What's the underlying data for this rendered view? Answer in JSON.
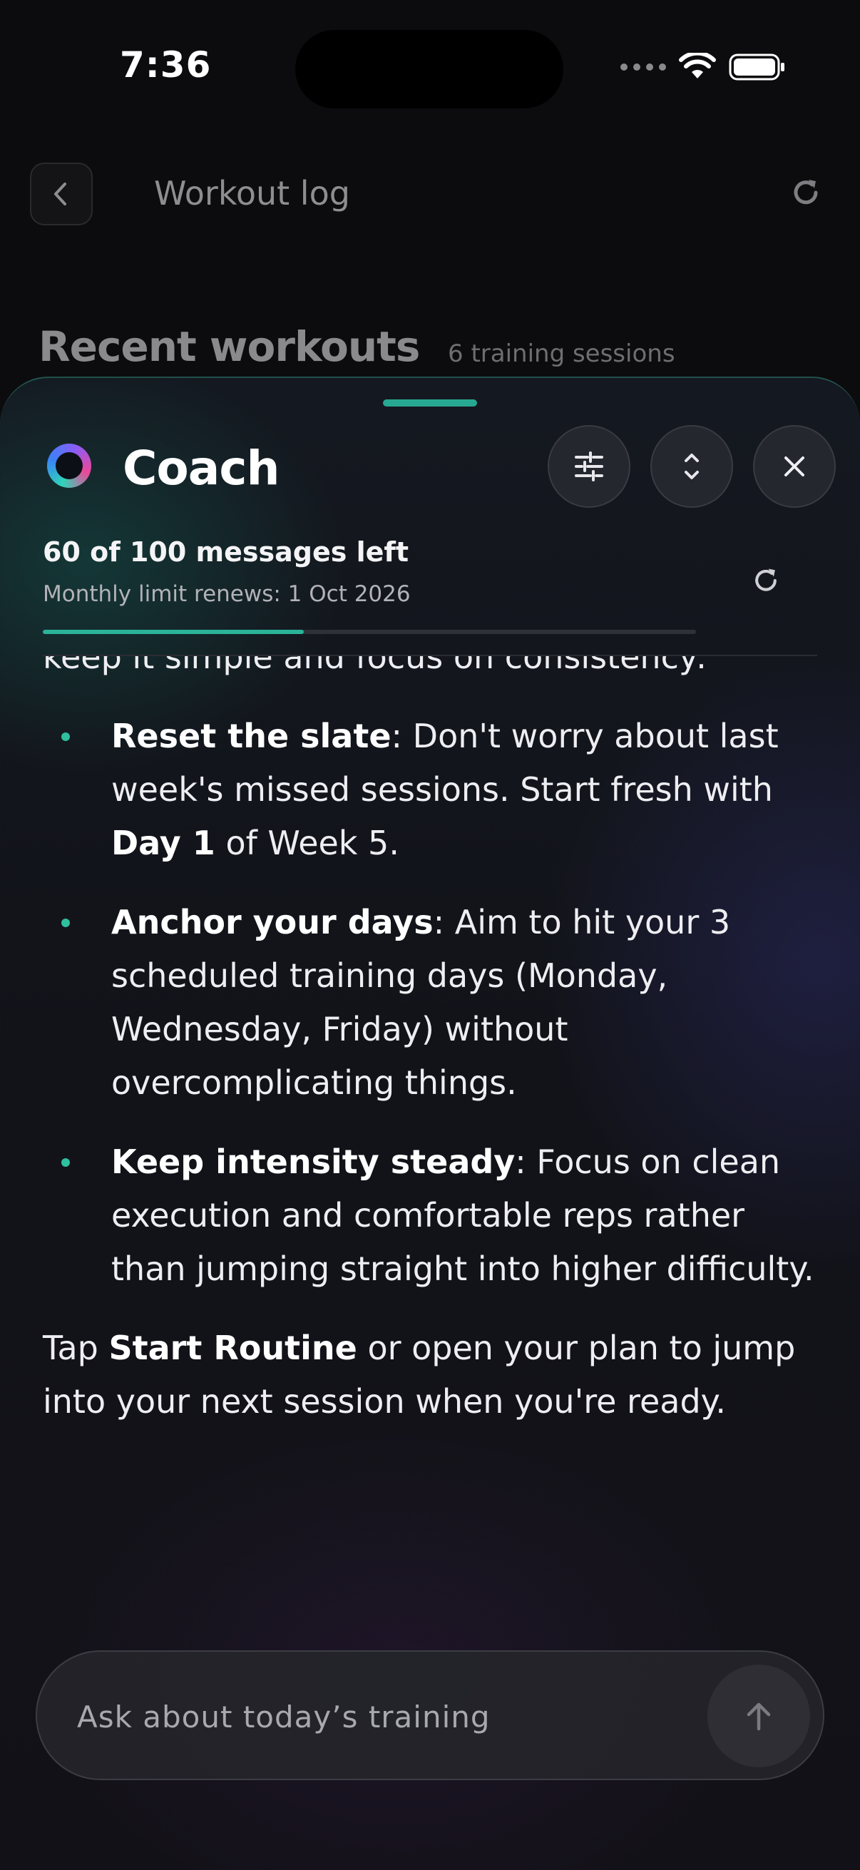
{
  "status_bar": {
    "time": "7:36"
  },
  "background_page": {
    "header_title": "Workout log",
    "section_title": "Recent workouts",
    "section_meta": "6 training sessions"
  },
  "coach_sheet": {
    "title": "Coach",
    "quota": {
      "summary": "60 of 100 messages left",
      "renewal": "Monthly limit renews: 1 Oct 2026",
      "used_fraction": 0.4
    },
    "message": {
      "intro_fragment": "keep it simple and focus on consistency:",
      "bullets": [
        {
          "bold": "Reset the slate",
          "text_a": ": Don't worry about last week's missed sessions. Start fresh with ",
          "bold_2": "Day 1",
          "text_b": " of Week 5."
        },
        {
          "bold": "Anchor your days",
          "text_a": ": Aim to hit your 3 scheduled training days (Monday, Wednesday, Friday) without overcomplicating things."
        },
        {
          "bold": "Keep intensity steady",
          "text_a": ": Focus on clean execution and comfortable reps rather than jumping straight into higher difficulty."
        }
      ],
      "closing_a": "Tap ",
      "closing_bold": "Start Routine",
      "closing_b": " or open your plan to jump into your next session when you're ready."
    },
    "input": {
      "placeholder": "Ask about today’s training",
      "value": ""
    }
  },
  "icons": {
    "back": "chevron-left-icon",
    "refresh": "refresh-icon",
    "tune": "sliders-icon",
    "expand": "expand-vertical-icon",
    "close": "close-icon",
    "send": "arrow-up-icon",
    "wifi": "wifi-icon",
    "battery": "battery-icon"
  },
  "colors": {
    "accent": "#2ab398",
    "background": "#0c0c0e",
    "sheet": "#131419"
  }
}
